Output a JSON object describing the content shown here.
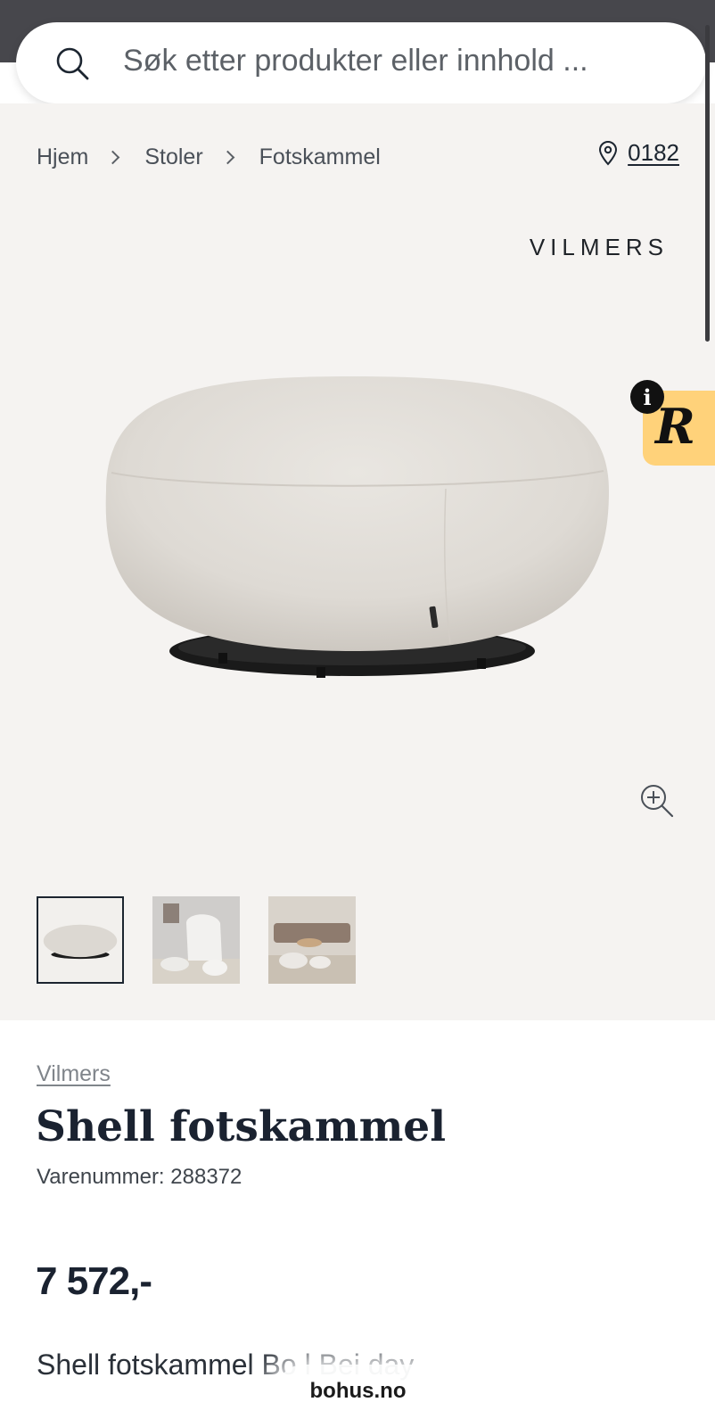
{
  "search": {
    "placeholder": "Søk etter produkter eller innhold ..."
  },
  "breadcrumb": [
    "Hjem",
    "Stoler",
    "Fotskammel"
  ],
  "store": {
    "label": "0182"
  },
  "gallery": {
    "brand_logo": "VILMERS",
    "badge_letter": "R",
    "info_glyph": "i",
    "thumbnail_count": 3,
    "active_thumbnail": 1
  },
  "product": {
    "brand": "Vilmers",
    "title": "Shell fotskammel",
    "sku_label": "Varenummer:",
    "sku_value": "288372",
    "price": "7 572,-",
    "description": "Shell fotskammel Bo   l Bei   day"
  },
  "browser": {
    "domain": "bohus.no"
  },
  "icons": [
    "search-icon",
    "chevron-right-icon",
    "location-pin-icon",
    "info-icon",
    "zoom-in-icon"
  ],
  "colors": {
    "top_bar": "#47474c",
    "gallery_bg": "#f5f3f1",
    "badge": "#ffd27a",
    "text_dark": "#1a2230"
  }
}
